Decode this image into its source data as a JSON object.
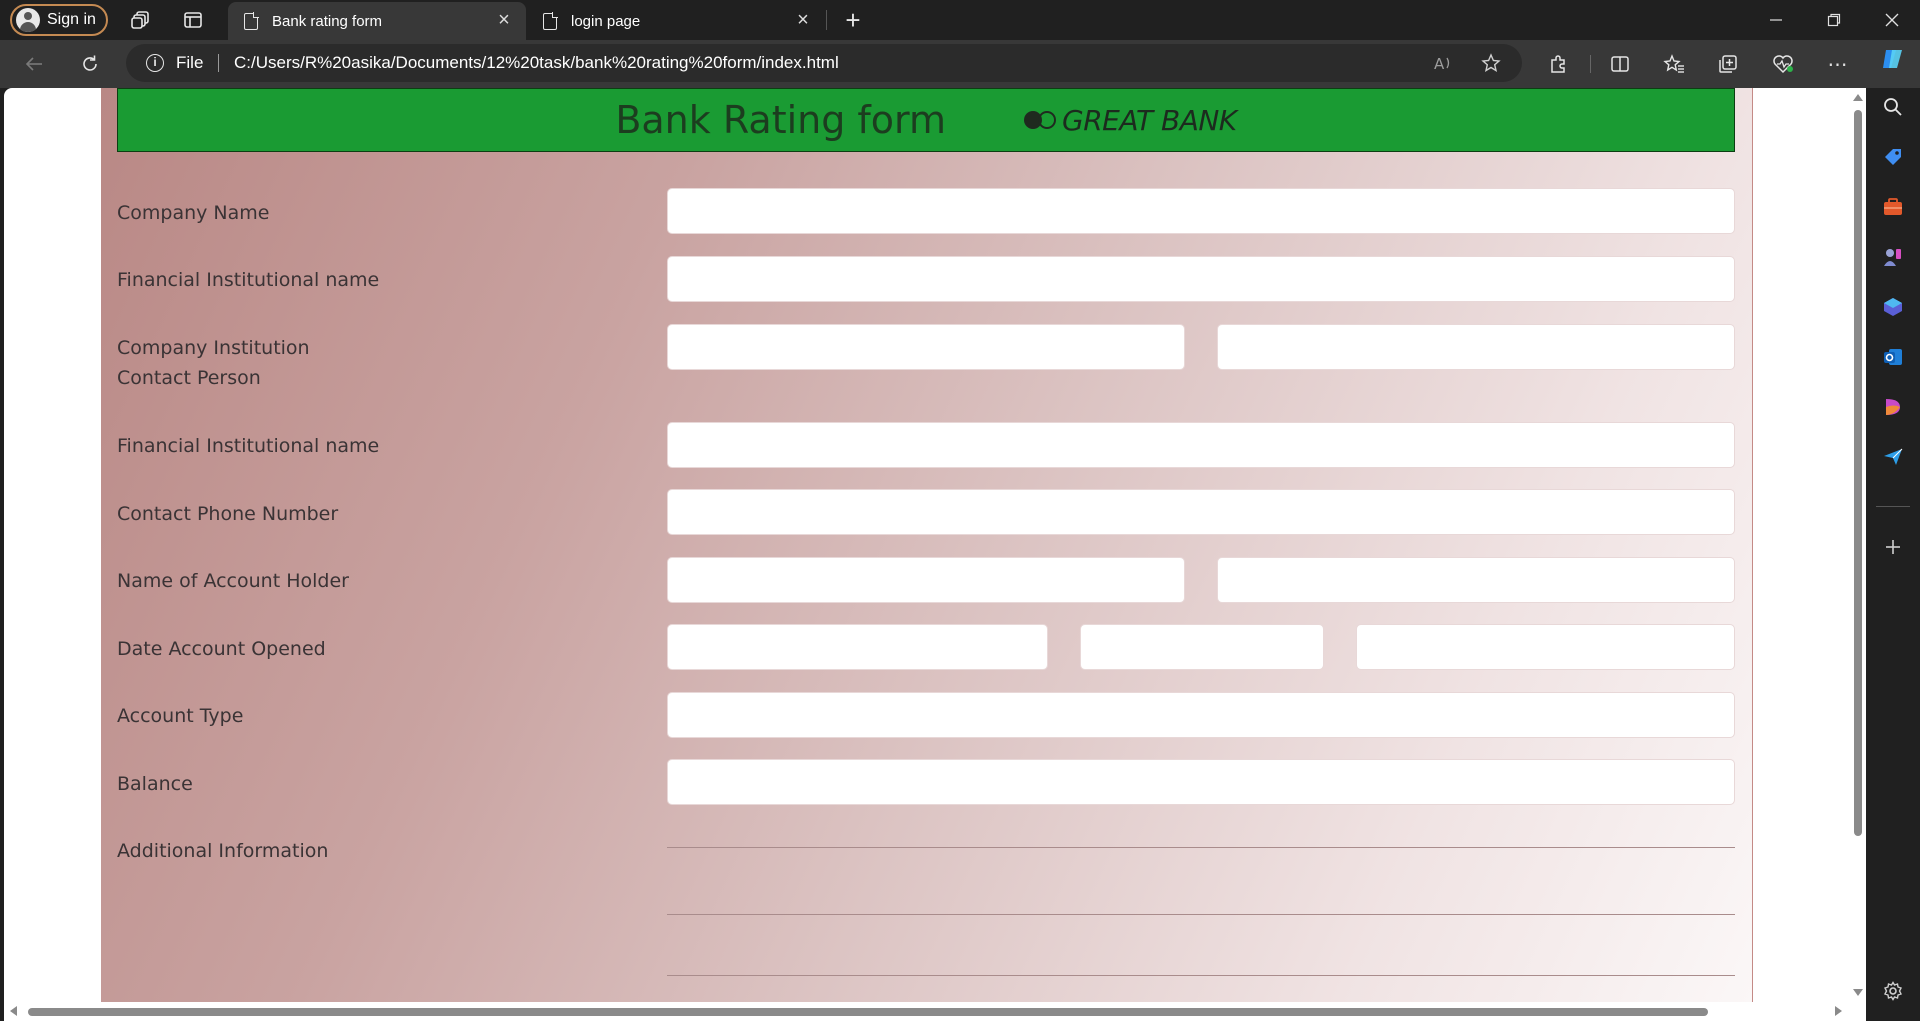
{
  "browser": {
    "sign_in_label": "Sign in",
    "tabs": [
      {
        "title": "Bank rating form",
        "active": true
      },
      {
        "title": "login page",
        "active": false
      }
    ],
    "new_tab_symbol": "+",
    "address": {
      "scheme_label": "File",
      "url": "C:/Users/R%20asika/Documents/12%20task/bank%20rating%20form/index.html"
    }
  },
  "page": {
    "banner_title": "Bank Rating form",
    "brand_name": "GREAT BANK",
    "labels": {
      "company_name": "Company Name",
      "financial_institution_name_1": "Financial Institutional name",
      "company_institution": "Company Institution",
      "contact_person": "Contact Person",
      "financial_institution_name_2": "Financial Institutional name",
      "contact_phone": "Contact Phone Number",
      "account_holder": "Name of Account Holder",
      "date_opened": "Date Account Opened",
      "account_type": "Account Type",
      "balance": "Balance",
      "additional_info": "Additional Information"
    }
  },
  "colors": {
    "banner": "#1a9b33",
    "page_gradient_start": "#b98885",
    "page_gradient_end": "#fbf7f7",
    "browser_chrome": "#202020",
    "accent_signin": "#c58a52"
  }
}
